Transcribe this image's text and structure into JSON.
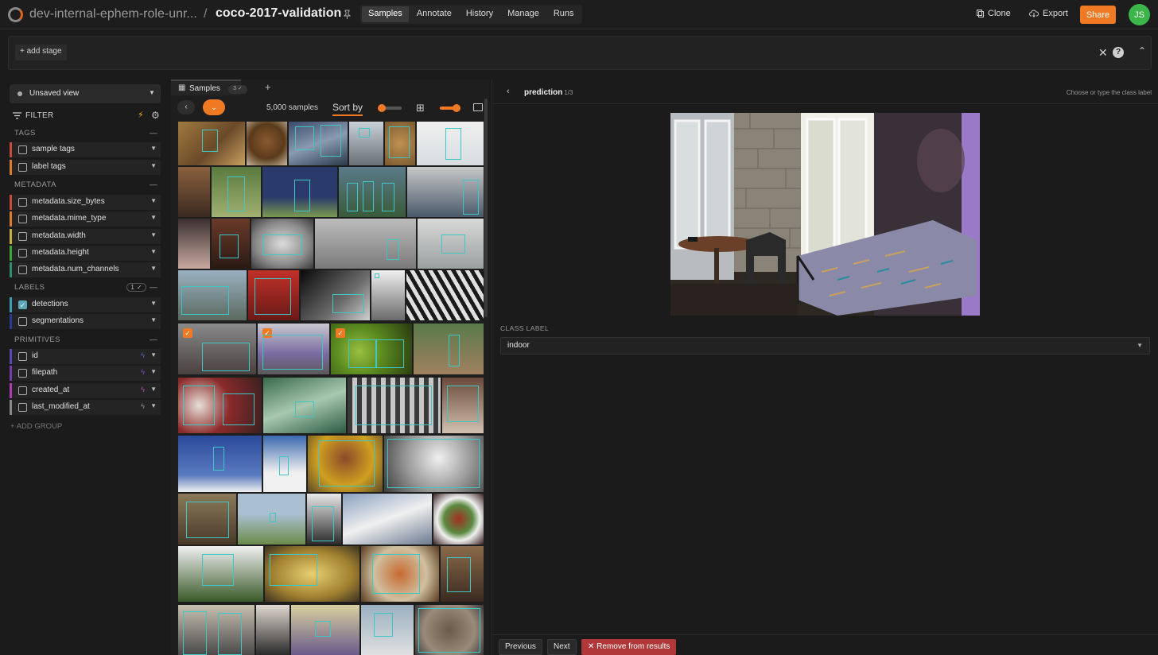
{
  "topbar": {
    "dataset_parent": "dev-internal-ephem-role-unr...",
    "separator": "/",
    "dataset_name": "coco-2017-validation",
    "nav": [
      "Samples",
      "Annotate",
      "History",
      "Manage",
      "Runs"
    ],
    "active_nav": "Samples",
    "clone_label": "Clone",
    "export_label": "Export",
    "share_label": "Share",
    "avatar_initials": "JS",
    "accent": "#f07a24",
    "avatar_color": "#3cb54a"
  },
  "stages": {
    "add_stage_label": "+ add stage",
    "help": "?"
  },
  "sidebar": {
    "view_label": "Unsaved view",
    "filter_label": "FILTER",
    "groups": [
      {
        "title": "TAGS",
        "fields": [
          {
            "name": "sample tags",
            "color": "#c94a3c"
          },
          {
            "name": "label tags",
            "color": "#e07a2c"
          }
        ]
      },
      {
        "title": "METADATA",
        "fields": [
          {
            "name": "metadata.size_bytes",
            "color": "#c94a3c"
          },
          {
            "name": "metadata.mime_type",
            "color": "#e07a2c"
          },
          {
            "name": "metadata.width",
            "color": "#c9b03c"
          },
          {
            "name": "metadata.height",
            "color": "#3ca83c"
          },
          {
            "name": "metadata.num_channels",
            "color": "#2f8f6f"
          }
        ]
      },
      {
        "title": "LABELS",
        "count": "1 ✓",
        "fields": [
          {
            "name": "detections",
            "color": "#3aa0b8",
            "checked": true
          },
          {
            "name": "segmentations",
            "color": "#2a3a9a"
          }
        ]
      },
      {
        "title": "PRIMITIVES",
        "fields": [
          {
            "name": "id",
            "color": "#5a4ab8"
          },
          {
            "name": "filepath",
            "color": "#7a3ab0"
          },
          {
            "name": "created_at",
            "color": "#b03ab0"
          },
          {
            "name": "last_modified_at",
            "color": "#888888"
          }
        ]
      }
    ],
    "add_group_label": "+ ADD GROUP"
  },
  "grid": {
    "tab_label": "Samples",
    "tab_badge": "3 ✓",
    "sample_count": "5,000 samples",
    "sort_label": "Sort by"
  },
  "modal": {
    "field_name": "prediction",
    "field_index": "1/3",
    "hint": "Choose or type the class label",
    "class_label_heading": "CLASS LABEL",
    "class_value": "indoor",
    "previous_label": "Previous",
    "next_label": "Next",
    "remove_label": "Remove from results"
  }
}
